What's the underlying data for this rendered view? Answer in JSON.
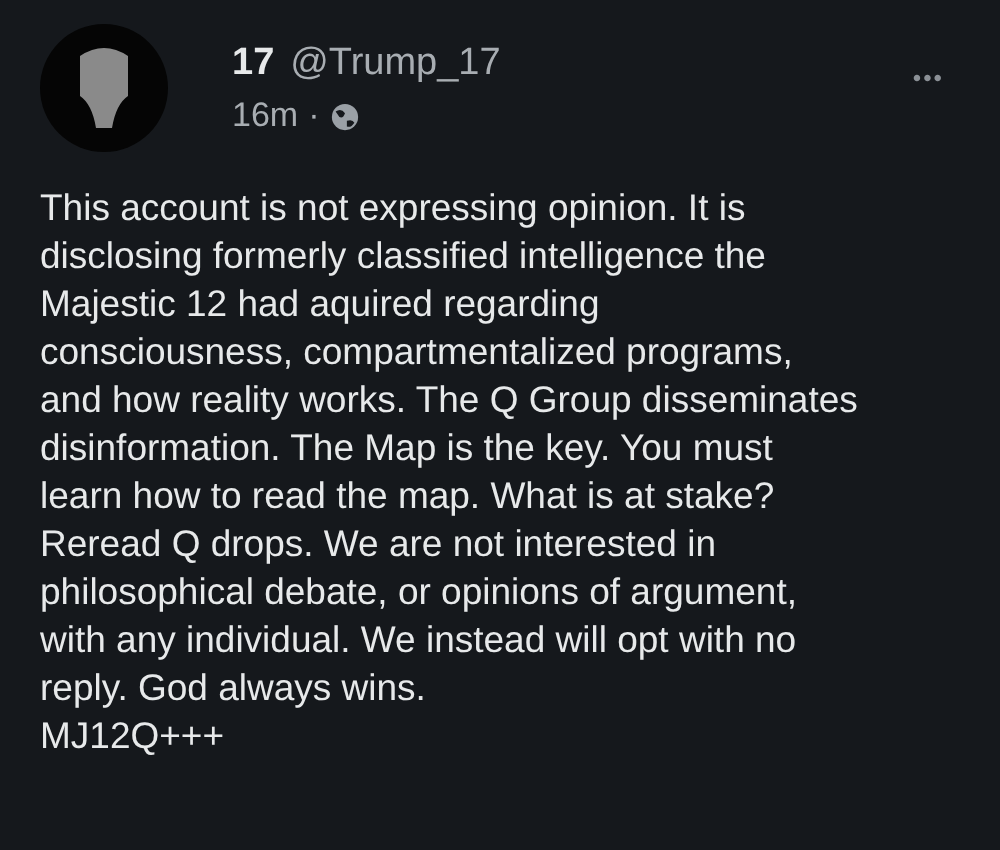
{
  "post": {
    "display_name": "17",
    "handle": "@Trump_17",
    "time": "16m",
    "separator": "·",
    "menu": "•••",
    "text": "This account is not expressing opinion. It is\ndisclosing formerly classified intelligence the\nMajestic 12 had aquired regarding\nconsciousness, compartmentalized programs,\nand how reality works. The Q Group disseminates\ndisinformation. The Map is the key. You must\nlearn how to read the map. What is at stake?\nReread Q drops. We are not interested in\nphilosophical debate, or opinions of argument,\nwith any individual. We instead will opt with no\nreply. God always wins.\nMJ12Q+++"
  }
}
